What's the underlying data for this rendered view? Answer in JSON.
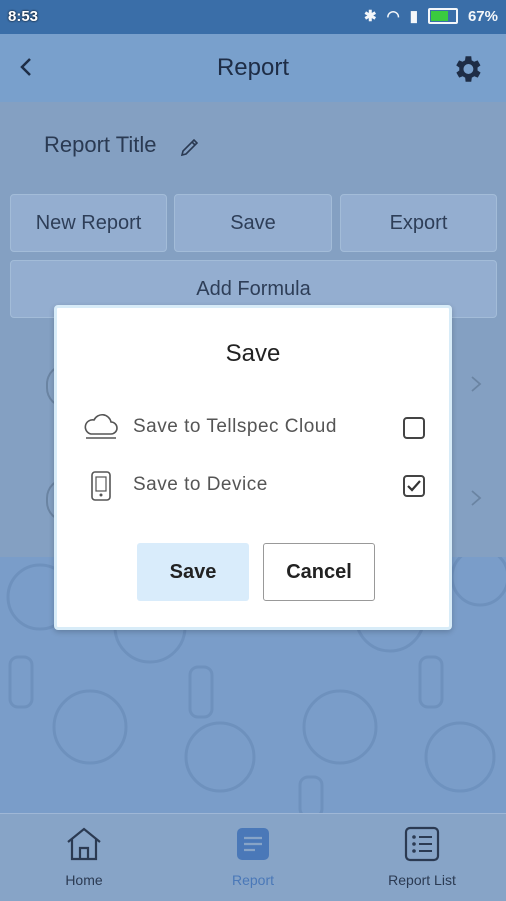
{
  "status_bar": {
    "time": "8:53",
    "battery": "67%"
  },
  "app_bar": {
    "title": "Report",
    "back_icon": "chevron-left-icon",
    "settings_icon": "gear-icon"
  },
  "report": {
    "title": "Report Title",
    "edit_icon": "pencil-icon",
    "buttons": {
      "new_report": "New Report",
      "save": "Save",
      "export": "Export",
      "add_formula": "Add Formula"
    }
  },
  "dialog": {
    "title": "Save",
    "options": [
      {
        "label": "Save to Tellspec Cloud",
        "icon": "cloud-icon",
        "checked": false
      },
      {
        "label": "Save to Device",
        "icon": "phone-icon",
        "checked": true
      }
    ],
    "save_label": "Save",
    "cancel_label": "Cancel",
    "accent": "#d9ecfb"
  },
  "bottom_nav": [
    {
      "label": "Home",
      "icon": "home-icon",
      "active": false
    },
    {
      "label": "Report",
      "icon": "report-icon",
      "active": true
    },
    {
      "label": "Report List",
      "icon": "list-icon",
      "active": false
    }
  ]
}
